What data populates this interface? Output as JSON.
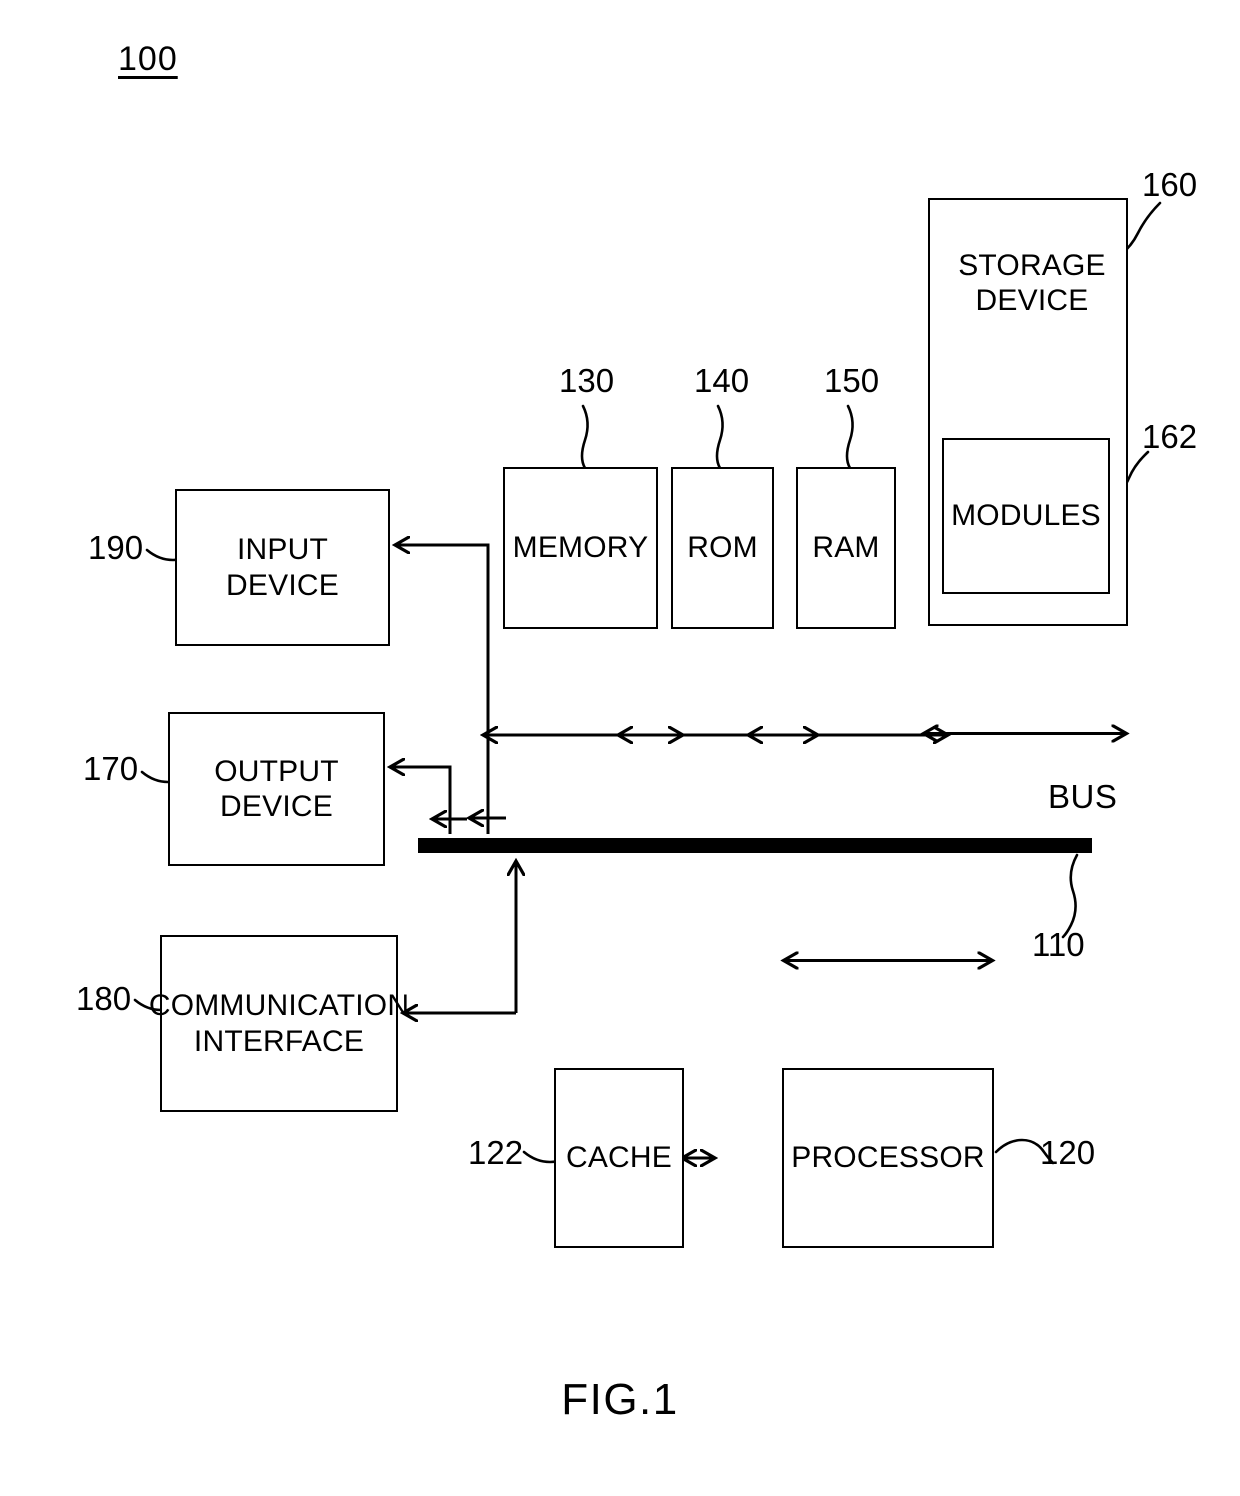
{
  "figure": {
    "number": "100",
    "caption": "FIG.1",
    "bus_label": "BUS"
  },
  "blocks": [
    {
      "id": "storage-device",
      "label": "STORAGE\nDEVICE",
      "ref": "160"
    },
    {
      "id": "modules",
      "label": "MODULES",
      "ref": "162"
    },
    {
      "id": "memory",
      "label": "MEMORY",
      "ref": "130"
    },
    {
      "id": "rom",
      "label": "ROM",
      "ref": "140"
    },
    {
      "id": "ram",
      "label": "RAM",
      "ref": "150"
    },
    {
      "id": "input-device",
      "label": "INPUT DEVICE",
      "ref": "190"
    },
    {
      "id": "output-device",
      "label": "OUTPUT\nDEVICE",
      "ref": "170"
    },
    {
      "id": "communication-interface",
      "label": "COMMUNICATION\nINTERFACE",
      "ref": "180"
    },
    {
      "id": "cache",
      "label": "CACHE",
      "ref": "122"
    },
    {
      "id": "processor",
      "label": "PROCESSOR",
      "ref": "120"
    },
    {
      "id": "bus",
      "label": "BUS",
      "ref": "110"
    }
  ],
  "refs": {
    "storage_device": "160",
    "modules": "162",
    "memory": "130",
    "rom": "140",
    "ram": "150",
    "input_device": "190",
    "output_device": "170",
    "communication_interface": "180",
    "cache": "122",
    "processor": "120",
    "bus": "110"
  },
  "labels": {
    "storage_device": "STORAGE\nDEVICE",
    "modules": "MODULES",
    "memory": "MEMORY",
    "rom": "ROM",
    "ram": "RAM",
    "input_device": "INPUT DEVICE",
    "output_device": "OUTPUT\nDEVICE",
    "communication_interface": "COMMUNICATION\nINTERFACE",
    "cache": "CACHE",
    "processor": "PROCESSOR"
  },
  "connections": [
    {
      "from": "memory",
      "to": "bus",
      "type": "bidirectional"
    },
    {
      "from": "rom",
      "to": "bus",
      "type": "bidirectional"
    },
    {
      "from": "ram",
      "to": "bus",
      "type": "bidirectional"
    },
    {
      "from": "storage-device",
      "to": "bus",
      "type": "bidirectional"
    },
    {
      "from": "processor",
      "to": "bus",
      "type": "bidirectional"
    },
    {
      "from": "cache",
      "to": "processor",
      "type": "bidirectional"
    },
    {
      "from": "bus",
      "to": "input-device",
      "type": "directed"
    },
    {
      "from": "bus",
      "to": "output-device",
      "type": "directed"
    },
    {
      "from": "communication-interface",
      "to": "bus",
      "type": "directed"
    }
  ],
  "colors": {
    "stroke": "#000000",
    "background": "#ffffff"
  }
}
